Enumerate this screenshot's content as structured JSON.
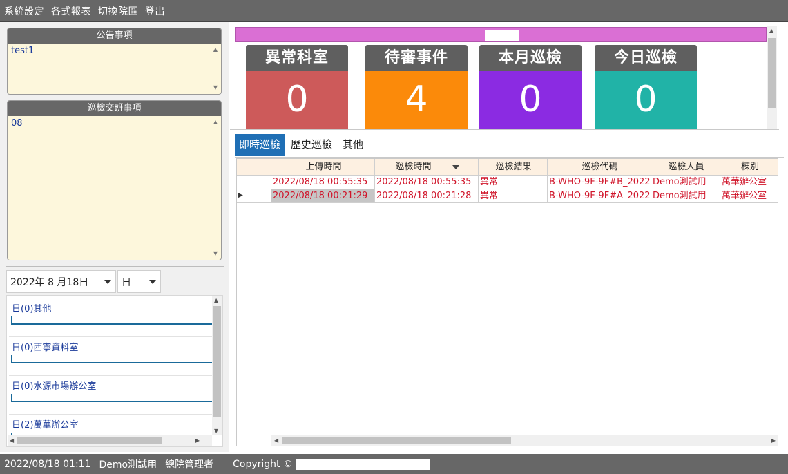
{
  "menu": [
    "系統設定",
    "各式報表",
    "切換院區",
    "登出"
  ],
  "announcement": {
    "title": "公告事項",
    "text": "test1"
  },
  "handover": {
    "title": "巡檢交班事項",
    "text": "08"
  },
  "date_select": {
    "value": "2022年 8 月18日"
  },
  "unit_select": {
    "value": "日"
  },
  "rooms": [
    {
      "label": "日(0)其他"
    },
    {
      "label": "日(0)西寧資料室"
    },
    {
      "label": "日(0)水源市場辦公室"
    },
    {
      "label": "日(2)萬華辦公室"
    }
  ],
  "cards": [
    {
      "label": "異常科室",
      "value": "0",
      "color": "#cd5a5a"
    },
    {
      "label": "待審事件",
      "value": "4",
      "color": "#fb8a0a"
    },
    {
      "label": "本月巡檢",
      "value": "0",
      "color": "#8b2be2"
    },
    {
      "label": "今日巡檢",
      "value": "0",
      "color": "#21b3a7"
    }
  ],
  "tabs": [
    "即時巡檢",
    "歷史巡檢",
    "其他"
  ],
  "grid": {
    "columns": [
      "上傳時間",
      "巡檢時間",
      "巡檢結果",
      "巡檢代碼",
      "巡檢人員",
      "棟別"
    ],
    "rows": [
      [
        "2022/08/18 00:55:35",
        "2022/08/18 00:55:35",
        "異常",
        "B-WHO-9F-9F#B_2022",
        "Demo測試用",
        "萬華辦公室"
      ],
      [
        "2022/08/18 00:21:29",
        "2022/08/18 00:21:28",
        "異常",
        "B-WHO-9F-9F#A_2022",
        "Demo測試用",
        "萬華辦公室"
      ]
    ]
  },
  "footer": {
    "datetime": "2022/08/18 01:11",
    "user": "Demo測試用",
    "role": "總院管理者",
    "copyright": "Copyright ©"
  }
}
